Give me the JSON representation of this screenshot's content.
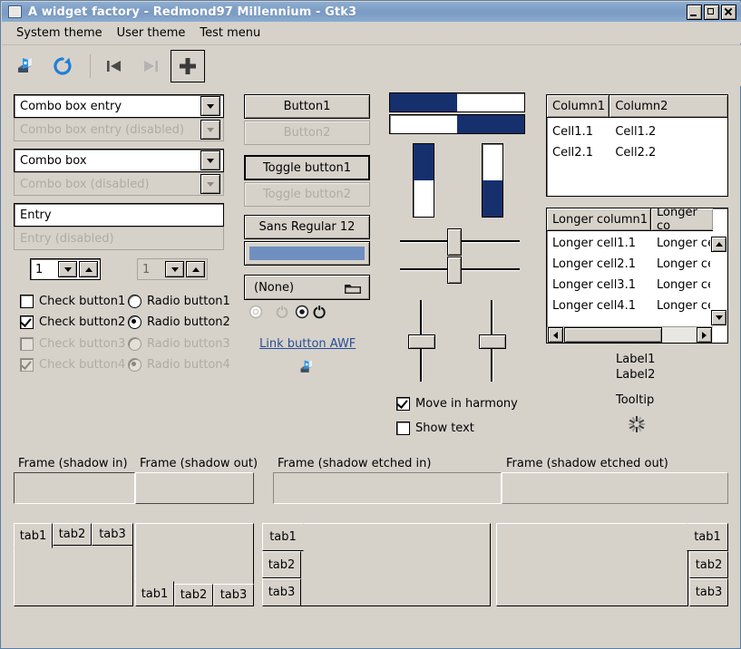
{
  "window": {
    "title": "A widget factory - Redmond97 Millennium - Gtk3",
    "icon": "window-icon",
    "buttons": {
      "minimize": "_",
      "maximize": "□",
      "close": "×"
    }
  },
  "menubar": {
    "items": [
      {
        "label": "System theme"
      },
      {
        "label": "User theme"
      },
      {
        "label": "Test menu"
      }
    ]
  },
  "toolbar": {
    "items": [
      {
        "name": "open-icon",
        "label": "Open"
      },
      {
        "name": "refresh-icon",
        "label": "Refresh"
      },
      {
        "name": "goto-first-icon",
        "label": "Go to first"
      },
      {
        "name": "goto-last-icon",
        "label": "Go to last"
      },
      {
        "name": "add-icon",
        "label": "Add"
      }
    ]
  },
  "combos": [
    {
      "value": "Combo box entry",
      "disabled": false,
      "has_entry": true
    },
    {
      "value": "Combo box entry (disabled)",
      "disabled": true,
      "has_entry": true
    },
    {
      "value": "Combo box",
      "disabled": false,
      "has_entry": false
    },
    {
      "value": "Combo box (disabled)",
      "disabled": true,
      "has_entry": false
    }
  ],
  "entries": [
    {
      "value": "Entry",
      "placeholder": "Entry",
      "disabled": false
    },
    {
      "value": "Entry (disabled)",
      "placeholder": "Entry (disabled)",
      "disabled": true
    }
  ],
  "spinbuttons": [
    {
      "value": "1",
      "disabled": false
    },
    {
      "value": "1",
      "disabled": true
    }
  ],
  "checkbuttons": [
    {
      "label": "Check button1",
      "checked": false,
      "disabled": false
    },
    {
      "label": "Check button2",
      "checked": true,
      "disabled": false
    },
    {
      "label": "Check button3",
      "checked": false,
      "disabled": true
    },
    {
      "label": "Check button4",
      "checked": true,
      "disabled": true
    }
  ],
  "radiobuttons": [
    {
      "label": "Radio button1",
      "selected": false,
      "disabled": false
    },
    {
      "label": "Radio button2",
      "selected": true,
      "disabled": false
    },
    {
      "label": "Radio button3",
      "selected": false,
      "disabled": true
    },
    {
      "label": "Radio button4",
      "selected": true,
      "disabled": true
    }
  ],
  "buttons": [
    {
      "label": "Button1",
      "disabled": false
    },
    {
      "label": "Button2",
      "disabled": true
    },
    {
      "label": "Toggle button1",
      "disabled": false,
      "toggled": true
    },
    {
      "label": "Toggle button2",
      "disabled": true,
      "toggled": false
    }
  ],
  "font_button": {
    "label": "Sans Regular   12"
  },
  "color_button": {
    "color": "#6f8fc0"
  },
  "file_button": {
    "label": "(None)",
    "icon": "folder-icon"
  },
  "switches": [
    {
      "name": "switch-off",
      "state": "off",
      "disabled": true
    },
    {
      "name": "switch-on",
      "state": "on",
      "disabled": false
    }
  ],
  "link_button": {
    "label": "Link button AWF"
  },
  "image": {
    "name": "app-image-icon"
  },
  "progressbars": [
    {
      "name": "progress-ltr",
      "value": 50,
      "direction": "ltr"
    },
    {
      "name": "progress-rtl",
      "value": 50,
      "direction": "rtl"
    }
  ],
  "vertical_progressbars": [
    {
      "name": "vprogress-top",
      "value": 50,
      "direction": "top"
    },
    {
      "name": "vprogress-bottom",
      "value": 50,
      "direction": "bottom"
    }
  ],
  "scales": {
    "horizontal": [
      {
        "value": 50
      },
      {
        "value": 50
      }
    ],
    "vertical": [
      {
        "value": 50
      },
      {
        "value": 50
      }
    ]
  },
  "scale_options": [
    {
      "label": "Move in harmony",
      "checked": true
    },
    {
      "label": "Show text",
      "checked": false
    }
  ],
  "treeview1": {
    "columns": [
      "Column1",
      "Column2"
    ],
    "rows": [
      [
        "Cell1.1",
        "Cell1.2"
      ],
      [
        "Cell2.1",
        "Cell2.2"
      ]
    ]
  },
  "treeview2": {
    "columns": [
      "Longer column1",
      "Longer co"
    ],
    "rows": [
      [
        "Longer cell1.1",
        "Longer ce"
      ],
      [
        "Longer cell2.1",
        "Longer ce"
      ],
      [
        "Longer cell3.1",
        "Longer ce"
      ],
      [
        "Longer cell4.1",
        "Longer ce"
      ]
    ]
  },
  "labels": [
    {
      "text": "Label1"
    },
    {
      "text": "Label2"
    },
    {
      "text": "Tooltip"
    }
  ],
  "spinner": {
    "name": "spinner-icon"
  },
  "frames": [
    {
      "title": "Frame (shadow in)",
      "style": "in"
    },
    {
      "title": "Frame (shadow out)",
      "style": "out"
    },
    {
      "title": "Frame (shadow etched in)",
      "style": "etched-in"
    },
    {
      "title": "Frame (shadow etched out)",
      "style": "etched-out"
    }
  ],
  "notebooks": [
    {
      "position": "top",
      "tabs": [
        "tab1",
        "tab2",
        "tab3"
      ],
      "selected": 0
    },
    {
      "position": "bottom",
      "tabs": [
        "tab1",
        "tab2",
        "tab3"
      ],
      "selected": 0
    },
    {
      "position": "left",
      "tabs": [
        "tab1",
        "tab2",
        "tab3"
      ],
      "selected": 0
    },
    {
      "position": "right",
      "tabs": [
        "tab1",
        "tab2",
        "tab3"
      ],
      "selected": 0
    }
  ],
  "colors": {
    "titlebar": "#7b9cc4",
    "background": "#d6d2ca",
    "progress_fill": "#16306e",
    "link": "#2a4d96",
    "disabled_text": "#b0aba2"
  }
}
